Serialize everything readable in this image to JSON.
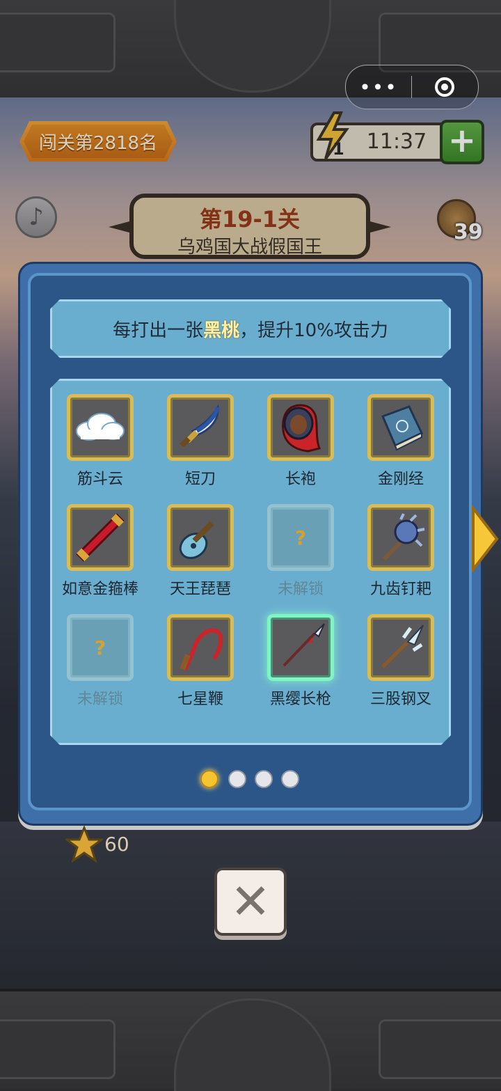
{
  "header": {
    "rank_label": "闯关第2818名",
    "energy_count": "1",
    "energy_time": "11:37",
    "add_energy_label": "+",
    "coin_count": "39"
  },
  "level": {
    "number": "第19-1关",
    "name": "乌鸡国大战假国王"
  },
  "modal": {
    "tip_prefix": "每打出一张",
    "tip_highlight": "黑桃",
    "tip_suffix": "，提升10%攻击力",
    "items": [
      {
        "label": "筋斗云",
        "icon": "cloud-icon",
        "locked": false
      },
      {
        "label": "短刀",
        "icon": "saber-icon",
        "locked": false
      },
      {
        "label": "长袍",
        "icon": "robe-icon",
        "locked": false
      },
      {
        "label": "金刚经",
        "icon": "scripture-book-icon",
        "locked": false
      },
      {
        "label": "如意金箍棒",
        "icon": "golden-staff-icon",
        "locked": false
      },
      {
        "label": "天王琵琶",
        "icon": "pipa-lute-icon",
        "locked": false
      },
      {
        "label": "未解锁",
        "icon": "question-icon",
        "locked": true
      },
      {
        "label": "九齿钉耙",
        "icon": "nine-tooth-rake-icon",
        "locked": false
      },
      {
        "label": "未解锁",
        "icon": "question-icon",
        "locked": true
      },
      {
        "label": "七星鞭",
        "icon": "whip-icon",
        "locked": false
      },
      {
        "label": "黑缨长枪",
        "icon": "spear-icon",
        "locked": false,
        "selected": true
      },
      {
        "label": "三股钢叉",
        "icon": "trident-icon",
        "locked": false
      }
    ],
    "page_count": 4,
    "current_page": 1
  },
  "footer": {
    "star_count": "60",
    "close_label": "✕"
  },
  "capsule": {
    "more_label": "•••"
  }
}
